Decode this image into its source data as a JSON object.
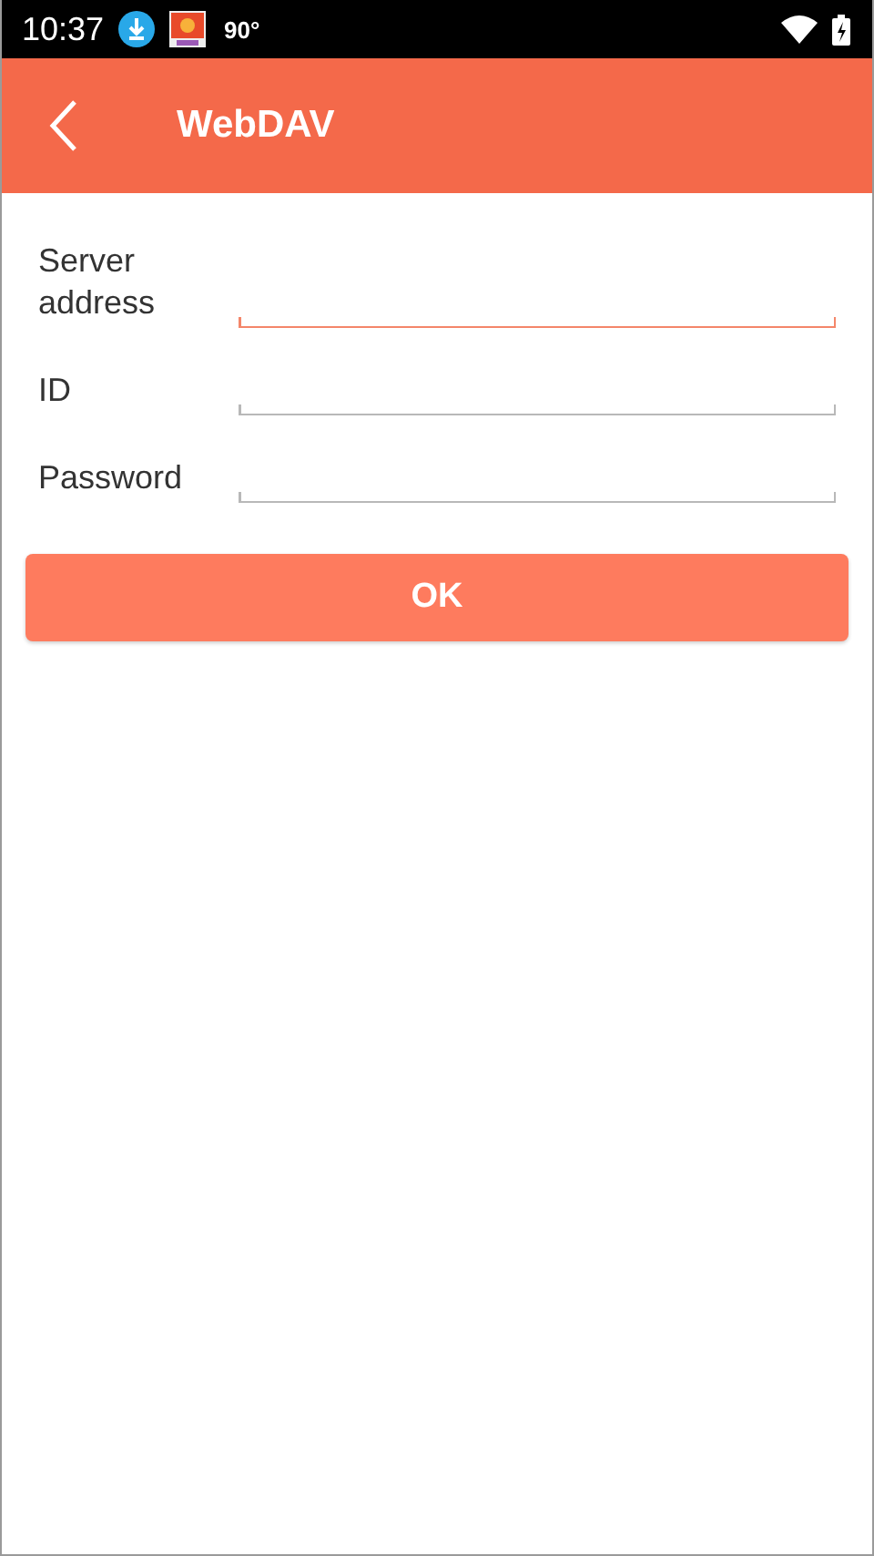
{
  "status_bar": {
    "time": "10:37",
    "temperature": "90°"
  },
  "app_bar": {
    "title": "WebDAV"
  },
  "form": {
    "fields": [
      {
        "label": "Server address",
        "focused": true
      },
      {
        "label": "ID",
        "focused": false
      },
      {
        "label": "Password",
        "focused": false
      }
    ]
  },
  "buttons": [
    "OK"
  ]
}
